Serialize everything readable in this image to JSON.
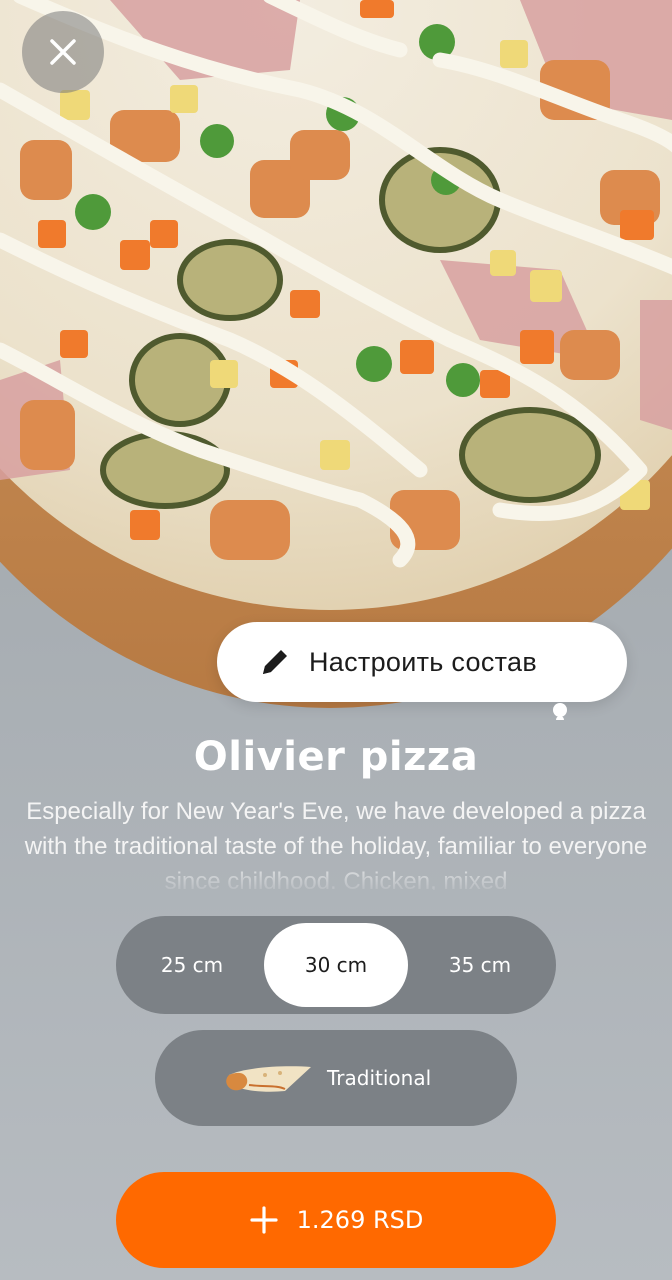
{
  "product": {
    "title": "Olivier pizza",
    "description": "Especially for New Year's Eve, we have developed a pizza with the traditional taste of the holiday, familiar to everyone since childhood. Chicken, mixed"
  },
  "actions": {
    "close_icon": "close-icon",
    "customize_label": "Настроить состав",
    "customize_icon": "pencil-icon"
  },
  "sizes": {
    "options": [
      "25 cm",
      "30 cm",
      "35 cm"
    ],
    "selected": "30 cm"
  },
  "dough": {
    "label": "Traditional",
    "icon": "crust-icon"
  },
  "cart": {
    "price_label": "1.269 RSD",
    "icon": "plus-icon"
  },
  "colors": {
    "accent": "#ff6900",
    "background": "#a7adb2",
    "selector": "#7c8186",
    "text_on_dark": "#ffffff"
  }
}
